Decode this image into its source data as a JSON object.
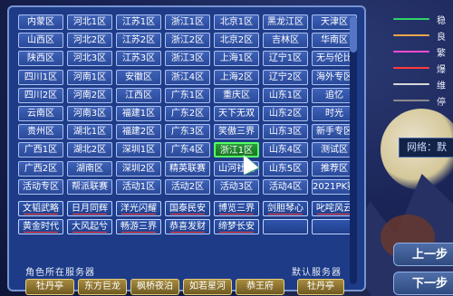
{
  "legend": [
    {
      "char": "稳",
      "color": "#2fd36a"
    },
    {
      "char": "良",
      "color": "#f0a64a"
    },
    {
      "char": "繁",
      "color": "#ff4bd1"
    },
    {
      "char": "爆",
      "color": "#ff3b3b"
    },
    {
      "char": "维",
      "color": "#d8d8d8"
    },
    {
      "char": "停",
      "color": "#8a8a8a"
    }
  ],
  "network_label": "网络：默",
  "side_buttons": {
    "prev": "上一步",
    "next": "下一步"
  },
  "rows": [
    [
      "内蒙区",
      "河北1区",
      "江苏1区",
      "浙江1区",
      "北京1区",
      "黑龙江区",
      "天津区"
    ],
    [
      "山西区",
      "河北2区",
      "江苏2区",
      "浙江2区",
      "北京2区",
      "吉林区",
      "华南区"
    ],
    [
      "陕西区",
      "河北3区",
      "江苏3区",
      "浙江3区",
      "上海1区",
      "辽宁1区",
      "无与伦比"
    ],
    [
      "四川1区",
      "河南1区",
      "安徽区",
      "浙江4区",
      "上海2区",
      "辽宁2区",
      "海外专区"
    ],
    [
      "四川2区",
      "河南2区",
      "江西区",
      "广东1区",
      "重庆区",
      "山东1区",
      "追忆"
    ],
    [
      "云南区",
      "河南3区",
      "福建1区",
      "广东2区",
      "天下无双",
      "山东2区",
      "时光"
    ],
    [
      "贵州区",
      "湖北1区",
      "福建2区",
      "广东3区",
      "笑傲三界",
      "山东3区",
      "新手专区"
    ],
    [
      "广西1区",
      "湖北2区",
      "深圳1区",
      "广东4区",
      "",
      "山东4区",
      "测试区"
    ],
    [
      "广西2区",
      "湖南区",
      "深圳2区",
      "精英联赛",
      "山河社稷",
      "山东5区",
      "推荐区"
    ],
    [
      "活动专区",
      "帮派联赛",
      "活动1区",
      "活动2区",
      "活动3区",
      "活动4区",
      "2021PK赛"
    ],
    [
      "文韬武略",
      "日月同辉",
      "洋光闪耀",
      "国泰民安",
      "博览三界",
      "剑胆琴心",
      "叱咤风云"
    ],
    [
      "黄金时代",
      "大风起兮",
      "畅游三界",
      "恭喜发财",
      "缔梦长安",
      "",
      ""
    ]
  ],
  "selected_server": "浙江1区",
  "footer": {
    "role_caption": "角色所在服务器",
    "default_caption": "默认服务器",
    "role_servers": [
      "牡丹亭",
      "东方巨龙",
      "枫桥夜泊",
      "如若星河",
      "恭王府"
    ],
    "default_server": "牡丹亭"
  }
}
